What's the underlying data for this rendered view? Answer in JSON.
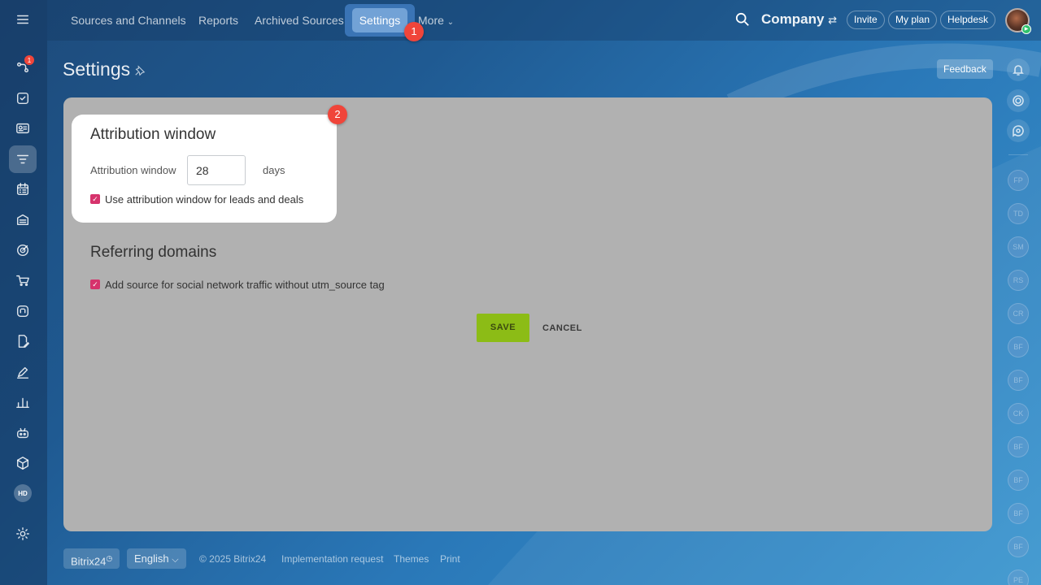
{
  "nav": {
    "tabs": [
      "Sources and Channels",
      "Reports",
      "Archived Sources",
      "Settings",
      "More"
    ],
    "active": "Settings"
  },
  "markers": [
    "1",
    "2"
  ],
  "header": {
    "company": "Company",
    "invite": "Invite",
    "my_plan": "My plan",
    "helpdesk": "Helpdesk"
  },
  "sidebar": {
    "notification_count": "1",
    "hd_label": "HD"
  },
  "page": {
    "title": "Settings",
    "feedback": "Feedback"
  },
  "attribution": {
    "title": "Attribution window",
    "field_label": "Attribution window",
    "value": "28",
    "unit": "days",
    "checkbox_label": "Use attribution window for leads and deals",
    "checked": true
  },
  "referring": {
    "title": "Referring domains",
    "checkbox_label": "Add source for social network traffic without utm_source tag",
    "checked": true
  },
  "actions": {
    "save": "SAVE",
    "cancel": "CANCEL"
  },
  "right_rail": {
    "users": [
      "FP",
      "TD",
      "SM",
      "RS",
      "CR",
      "BF",
      "BF",
      "CK",
      "BF",
      "BF",
      "BF",
      "BF",
      "PE"
    ]
  },
  "footer": {
    "brand": "Bitrix24",
    "language": "English",
    "copyright": "© 2025 Bitrix24",
    "links": [
      "Implementation request",
      "Themes",
      "Print"
    ]
  },
  "colors": {
    "accent_save": "#8cbc16",
    "checkbox": "#d6336c",
    "marker": "#f0453a"
  }
}
